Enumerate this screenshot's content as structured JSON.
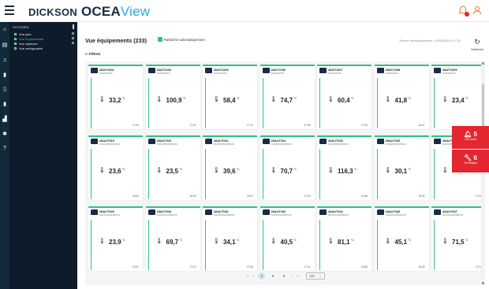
{
  "brand": {
    "dickson": "DICKSON",
    "ocea": "OCEA",
    "view": "View"
  },
  "sidebar": {
    "section": "ACCUEIL",
    "items": [
      {
        "label": "Vue plan",
        "active": false
      },
      {
        "label": "Vue équipements",
        "active": true
      },
      {
        "label": "Vue capteurs",
        "active": false
      },
      {
        "label": "Vue cartographie",
        "active": false
      }
    ]
  },
  "header": {
    "title": "Vue équipements (233)",
    "auto_refresh_label": "Rafraîchir automatiquement",
    "last_refresh": "Dernier rafraîchissement : 02/04/2020 à 17:20",
    "refresh_label": "Rafraîchir",
    "filters_label": "Filtres"
  },
  "cards": [
    {
      "id": "28ATC003",
      "type": "Autoclaves",
      "value": "33,2",
      "unit": "°C",
      "time": "17:09"
    },
    {
      "id": "28ATC004",
      "type": "Autoclaves",
      "value": "100,9",
      "unit": "°C",
      "time": "17:02"
    },
    {
      "id": "28ATC005",
      "type": "Autoclaves",
      "value": "58,4",
      "unit": "°C",
      "time": "17:13"
    },
    {
      "id": "28ATC006",
      "type": "Autoclaves",
      "value": "74,7",
      "unit": "°C",
      "time": "17:05"
    },
    {
      "id": "28ATC007",
      "type": "Autoclaves",
      "value": "60,4",
      "unit": "°C",
      "time": "17:00"
    },
    {
      "id": "28ATC008",
      "type": "Autoclaves",
      "value": "41,8",
      "unit": "°C",
      "time": "16:41"
    },
    {
      "id": "28ATC009",
      "type": "Autoclaves",
      "value": "23,4",
      "unit": "°C",
      "time": ""
    },
    {
      "id": "28AUT019",
      "type": "Autopréparateurs",
      "value": "23,6",
      "unit": "°C",
      "time": "16:52"
    },
    {
      "id": "28AUT020",
      "type": "Autopréparateurs",
      "value": "23,5",
      "unit": "°C",
      "time": "16:53"
    },
    {
      "id": "28AUT021",
      "type": "Autopréparateurs",
      "value": "39,6",
      "unit": "°C",
      "time": "16:47"
    },
    {
      "id": "28AUT024",
      "type": "Autopréparateurs",
      "value": "70,7",
      "unit": "°C",
      "time": "17:00"
    },
    {
      "id": "28AUT025",
      "type": "Autopréparateurs",
      "value": "116,3",
      "unit": "°C",
      "time": "16:46"
    },
    {
      "id": "28AUT026",
      "type": "Autopréparateurs",
      "value": "30,1",
      "unit": "°C",
      "time": "16:52"
    },
    {
      "id": "28AUT0",
      "type": "Autopré",
      "value": "23,",
      "unit": "",
      "time": "17:05"
    },
    {
      "id": "28AUT029",
      "type": "Autopréparateurs",
      "value": "23,9",
      "unit": "°C",
      "time": "16:47"
    },
    {
      "id": "28AUT030",
      "type": "Autopréparateurs",
      "value": "69,7",
      "unit": "°C",
      "time": "17:12"
    },
    {
      "id": "28AUT031",
      "type": "Autopréparateurs",
      "value": "34,1",
      "unit": "°C",
      "time": "17:06"
    },
    {
      "id": "28AUT032",
      "type": "Autopréparateurs",
      "value": "40,5",
      "unit": "°C",
      "time": "17:14"
    },
    {
      "id": "28AUT034",
      "type": "Autopréparateurs",
      "value": "81,1",
      "unit": "°C",
      "time": "16:55"
    },
    {
      "id": "28AUT036",
      "type": "Autopréparateurs",
      "value": "45,1",
      "unit": "°C",
      "time": "16:46"
    },
    {
      "id": "28AUT037",
      "type": "Autopréparateurs",
      "value": "71,5",
      "unit": "°C",
      "time": "17:12"
    }
  ],
  "alerts": [
    {
      "count": "5",
      "label": "Sur seuil",
      "icon": "bell-icon"
    },
    {
      "count": "6",
      "label": "Technique",
      "icon": "wrench-icon"
    }
  ],
  "pagination": {
    "pages": [
      "1",
      "2",
      "3"
    ],
    "active": "1",
    "page_size": "100"
  },
  "colors": {
    "accent_green": "#2ec27e",
    "alert_red": "#e3262f",
    "nav_dark": "#0e1b2b",
    "brand_blue": "#27a8e0"
  }
}
